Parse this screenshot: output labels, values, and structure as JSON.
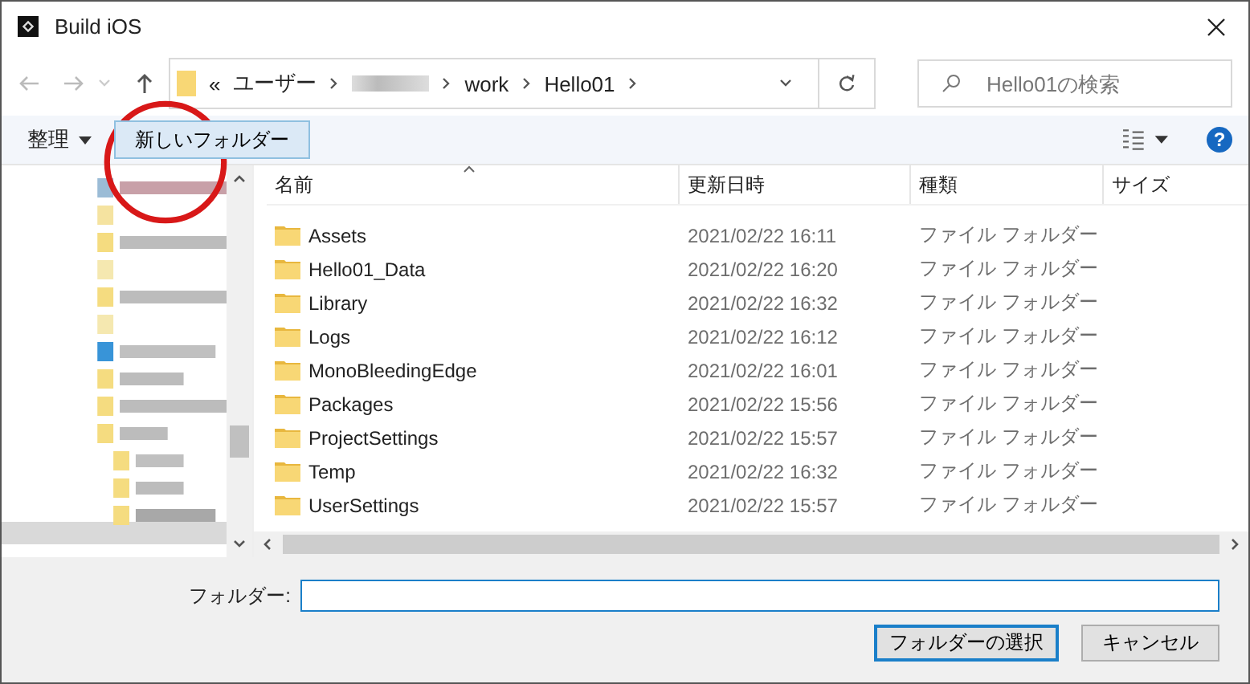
{
  "window": {
    "title": "Build iOS"
  },
  "breadcrumb": {
    "overflow": "«",
    "items": [
      {
        "label": "ユーザー",
        "kind": "text"
      },
      {
        "kind": "blurred"
      },
      {
        "label": "work",
        "kind": "text"
      },
      {
        "label": "Hello01",
        "kind": "text"
      }
    ]
  },
  "search": {
    "placeholder": "Hello01の検索"
  },
  "toolbar": {
    "organize": "整理",
    "new_folder": "新しいフォルダー",
    "help": "?"
  },
  "table": {
    "columns": [
      "名前",
      "更新日時",
      "種類",
      "サイズ"
    ],
    "rows": [
      {
        "name": "Assets",
        "modified": "2021/02/22 16:11",
        "type": "ファイル フォルダー"
      },
      {
        "name": "Hello01_Data",
        "modified": "2021/02/22 16:20",
        "type": "ファイル フォルダー"
      },
      {
        "name": "Library",
        "modified": "2021/02/22 16:32",
        "type": "ファイル フォルダー"
      },
      {
        "name": "Logs",
        "modified": "2021/02/22 16:12",
        "type": "ファイル フォルダー"
      },
      {
        "name": "MonoBleedingEdge",
        "modified": "2021/02/22 16:01",
        "type": "ファイル フォルダー"
      },
      {
        "name": "Packages",
        "modified": "2021/02/22 15:56",
        "type": "ファイル フォルダー"
      },
      {
        "name": "ProjectSettings",
        "modified": "2021/02/22 15:57",
        "type": "ファイル フォルダー"
      },
      {
        "name": "Temp",
        "modified": "2021/02/22 16:32",
        "type": "ファイル フォルダー"
      },
      {
        "name": "UserSettings",
        "modified": "2021/02/22 15:57",
        "type": "ファイル フォルダー"
      }
    ]
  },
  "folder_field": {
    "label": "フォルダー:"
  },
  "buttons": [
    {
      "label": "フォルダーの選択",
      "kind": "primary"
    },
    {
      "label": "キャンセル",
      "kind": "secondary"
    }
  ]
}
